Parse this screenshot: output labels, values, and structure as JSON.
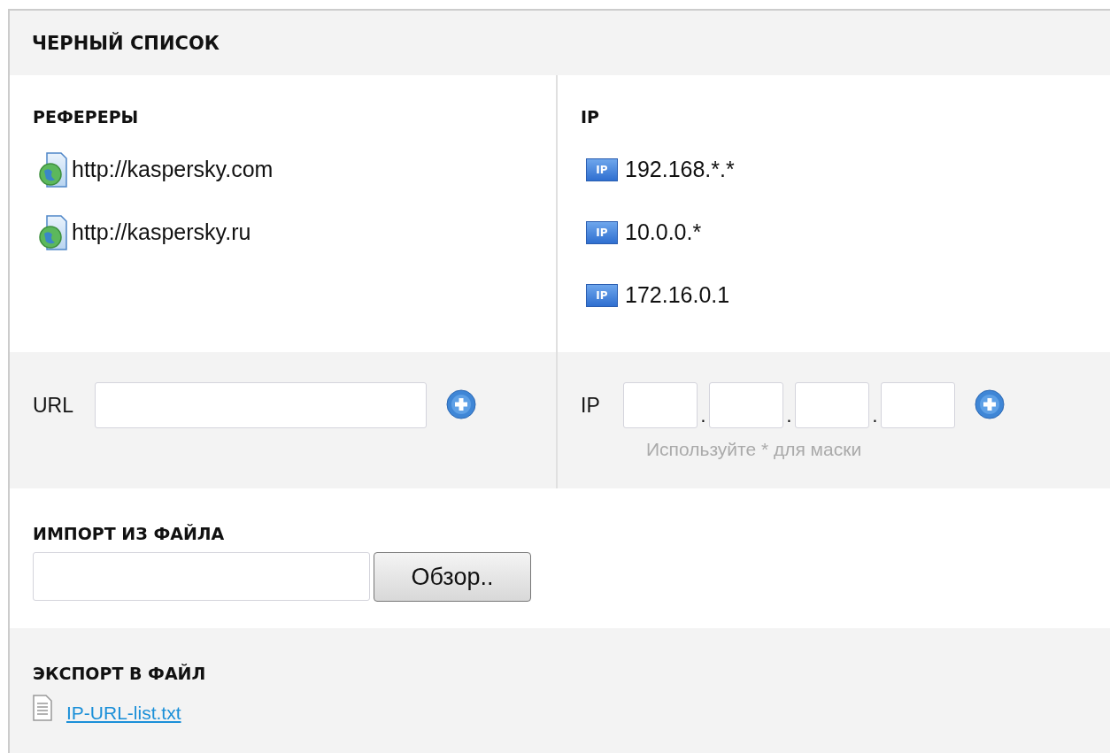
{
  "title": "ЧЕРНЫЙ СПИСОК",
  "referrers": {
    "heading": "РЕФЕРЕРЫ",
    "items": [
      {
        "text": "http://kaspersky.com"
      },
      {
        "text": "http://kaspersky.ru"
      }
    ]
  },
  "ips": {
    "heading": "IP",
    "items": [
      {
        "badge": "IP",
        "text": "192.168.*.*"
      },
      {
        "badge": "IP",
        "text": "10.0.0.*"
      },
      {
        "badge": "IP",
        "text": "172.16.0.1"
      }
    ]
  },
  "url_form": {
    "label": "URL"
  },
  "ip_form": {
    "label": "IP",
    "separators": [
      ".",
      ".",
      "."
    ],
    "hint": "Используйте * для маски"
  },
  "import": {
    "heading": "ИМПОРТ ИЗ ФАЙЛА",
    "button": "Обзор.."
  },
  "export": {
    "heading": "ЭКСПОРТ В ФАЙЛ",
    "link": "IP-URL-list.txt"
  }
}
